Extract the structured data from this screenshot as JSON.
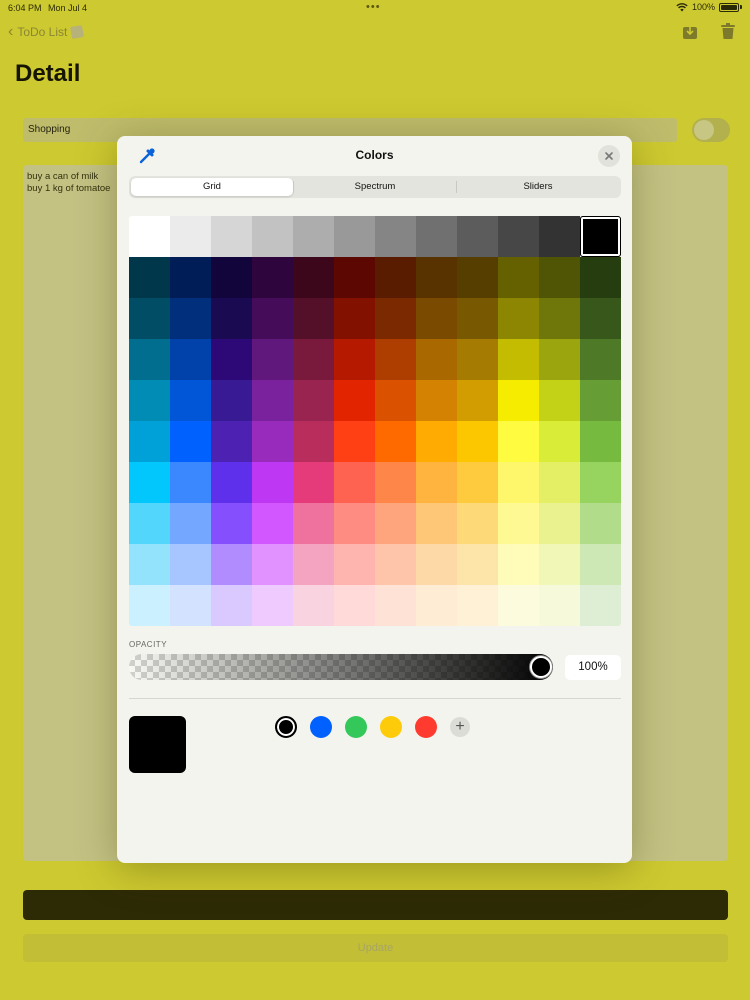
{
  "status_bar": {
    "time": "6:04 PM",
    "date": "Mon Jul 4",
    "battery": "100%"
  },
  "nav": {
    "back_label": "ToDo List",
    "title": "Detail"
  },
  "form": {
    "title_value": "Shopping",
    "toggle_on": false,
    "notes": [
      "buy a can of milk",
      "buy 1 kg of tomatoe"
    ],
    "color_value": "#2d2a06",
    "update_label": "Update"
  },
  "picker": {
    "title": "Colors",
    "tabs": [
      {
        "label": "Grid",
        "active": true
      },
      {
        "label": "Spectrum",
        "active": false
      },
      {
        "label": "Sliders",
        "active": false
      }
    ],
    "grid": [
      [
        "#ffffff",
        "#ebebeb",
        "#d6d6d6",
        "#c2c2c2",
        "#adadad",
        "#999999",
        "#858585",
        "#707070",
        "#5c5c5c",
        "#474747",
        "#333333",
        "#000000"
      ],
      [
        "#00374a",
        "#011d57",
        "#11053b",
        "#2e063d",
        "#3c071b",
        "#5c0701",
        "#5a1c00",
        "#583300",
        "#563d00",
        "#666100",
        "#4f5504",
        "#263e0f"
      ],
      [
        "#004d65",
        "#012f7b",
        "#1a0a52",
        "#450d59",
        "#551029",
        "#831100",
        "#7b2900",
        "#7a4a00",
        "#785800",
        "#8c8602",
        "#6f760a",
        "#38571a"
      ],
      [
        "#016e8f",
        "#0042a9",
        "#2c0977",
        "#61187c",
        "#791a3d",
        "#b51a00",
        "#ad3e00",
        "#a96800",
        "#a67b01",
        "#c4bc00",
        "#9ba50e",
        "#4e7a27"
      ],
      [
        "#008cb4",
        "#0056d6",
        "#371a94",
        "#7a219e",
        "#99244f",
        "#e22400",
        "#da5100",
        "#d38301",
        "#d19d01",
        "#f5ec00",
        "#c3d117",
        "#669d34"
      ],
      [
        "#00a1d8",
        "#0061fe",
        "#4d22b2",
        "#982abc",
        "#b92d5d",
        "#ff4015",
        "#ff6a00",
        "#ffab01",
        "#fdc700",
        "#fefb41",
        "#d9ec37",
        "#76bb40"
      ],
      [
        "#01c7fc",
        "#3a87fe",
        "#5e30eb",
        "#be38f3",
        "#e63b7a",
        "#fe6250",
        "#fe8648",
        "#feb43f",
        "#fecb3e",
        "#fff76b",
        "#e4ef65",
        "#96d35f"
      ],
      [
        "#52d6fc",
        "#74a7ff",
        "#864ffd",
        "#d357fe",
        "#ee719e",
        "#ff8c82",
        "#fea57d",
        "#fec777",
        "#fed977",
        "#fff994",
        "#eaf28f",
        "#b1dd8b"
      ],
      [
        "#93e3fc",
        "#a7c6ff",
        "#b18cfe",
        "#e292fe",
        "#f4a4c0",
        "#ffb5af",
        "#ffc5ab",
        "#fed9a8",
        "#fde4a8",
        "#fffbb9",
        "#f1f7b7",
        "#cde8b5"
      ],
      [
        "#cbf0ff",
        "#d3e2ff",
        "#d9c9fe",
        "#efcaff",
        "#f9d3e0",
        "#ffdad8",
        "#ffe2d6",
        "#feecd4",
        "#fef1d5",
        "#fdfbdd",
        "#f6fadb",
        "#deeed4"
      ]
    ],
    "selected_color": "#000000",
    "opacity_label": "OPACITY",
    "opacity_percent": 100,
    "opacity_value": "100%",
    "saved_swatches": [
      "#000000",
      "#0061fe",
      "#34c759",
      "#fecb0a",
      "#ff3b30"
    ]
  }
}
